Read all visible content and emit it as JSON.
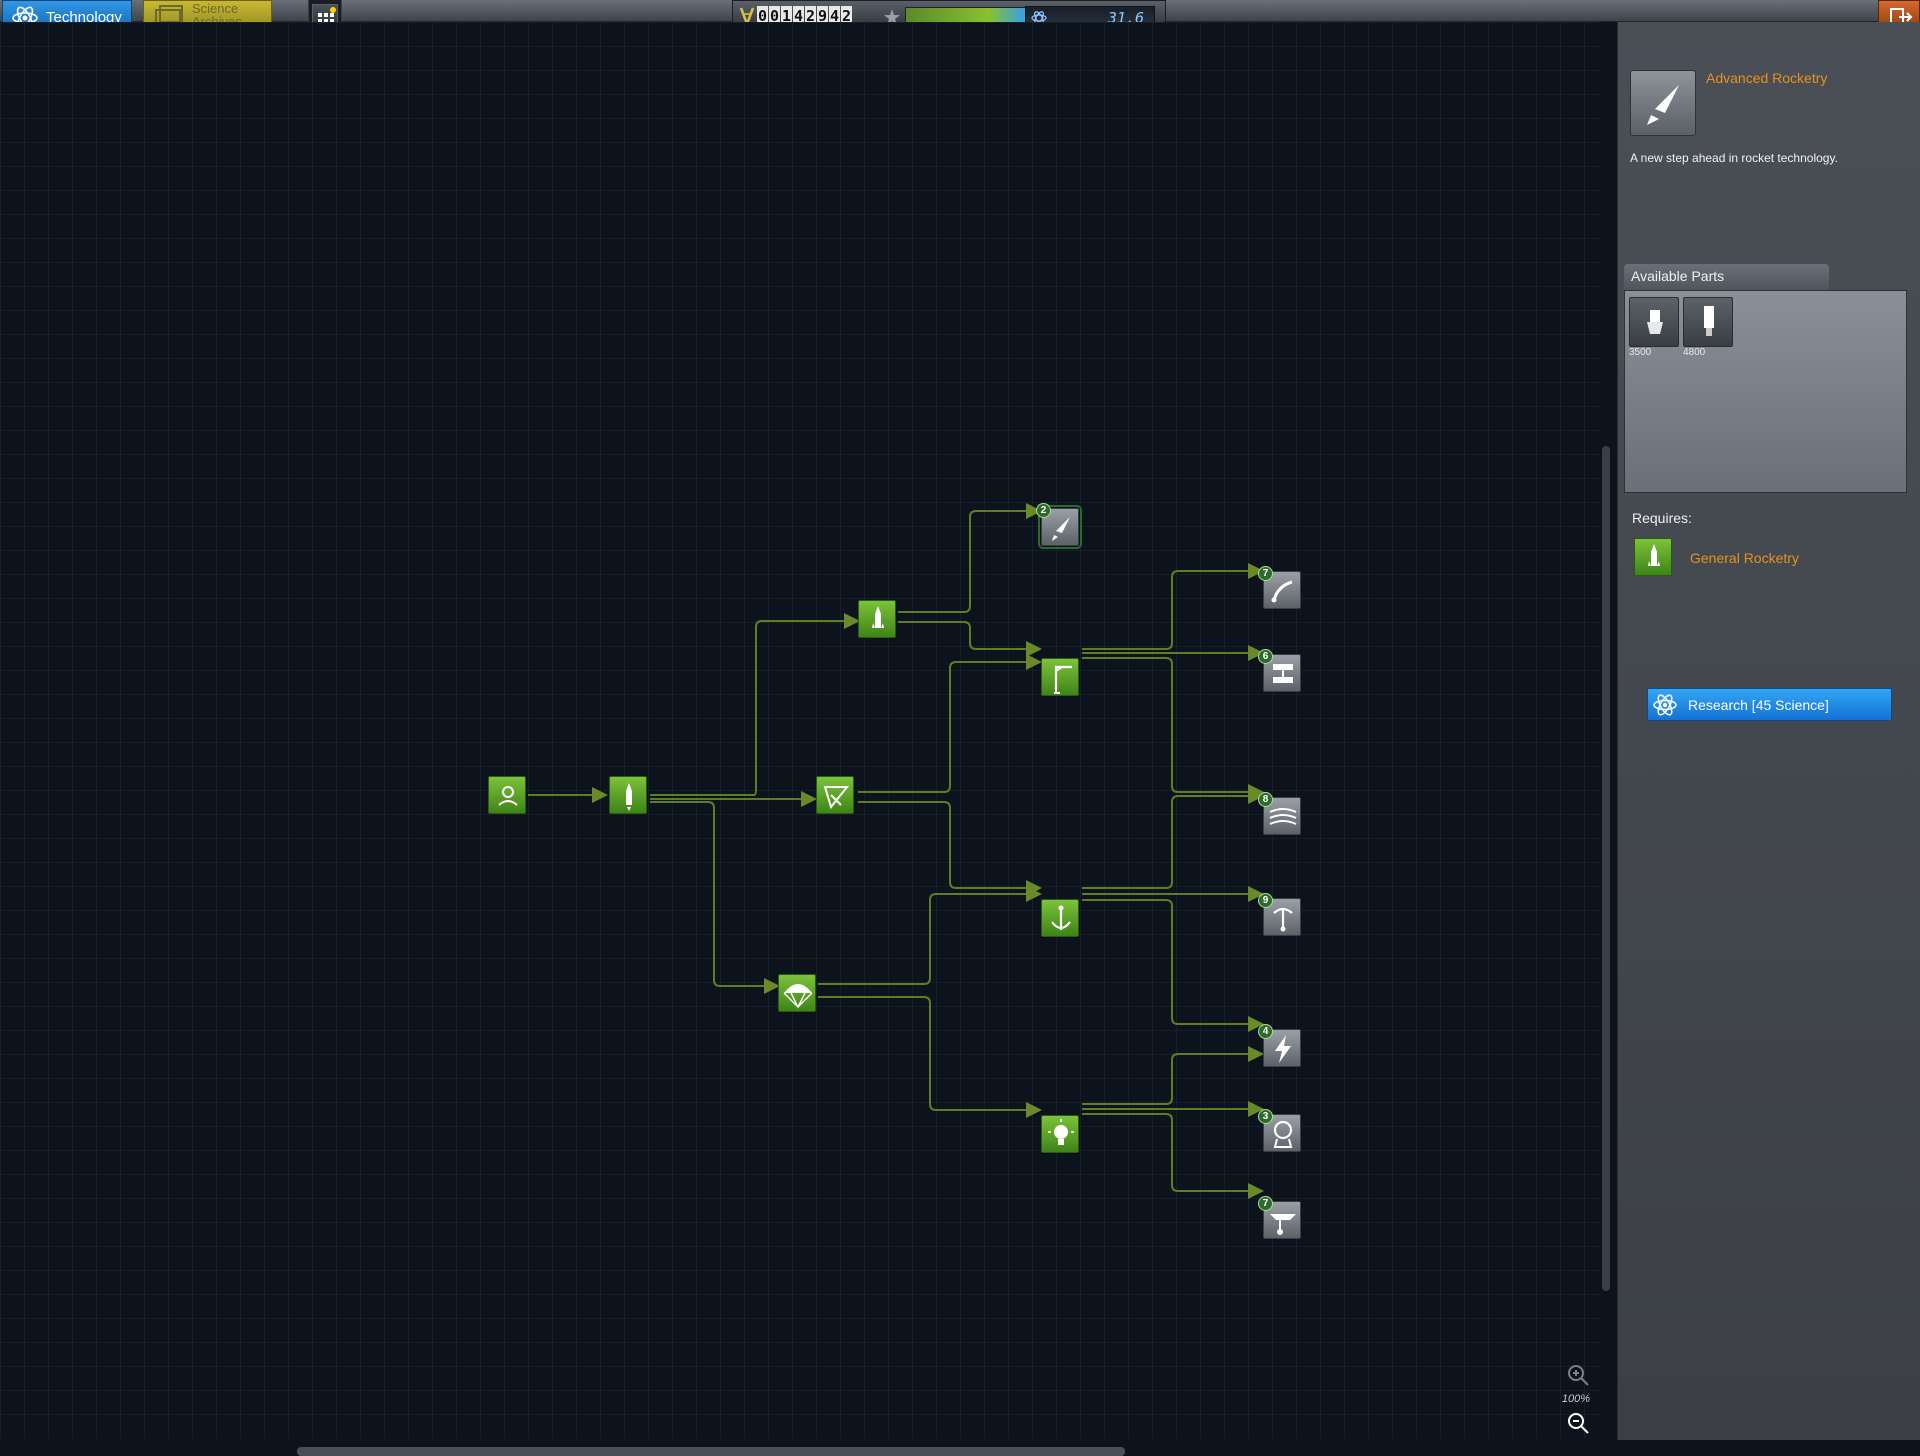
{
  "tabs": {
    "technology": "Technology",
    "science_archives": "Science Archives"
  },
  "hud": {
    "funds_digits": [
      "0",
      "0",
      "1",
      "4",
      "2",
      "9",
      "4",
      "2"
    ],
    "science": "31.6"
  },
  "zoom": "100%",
  "selected_tech": {
    "title": "Advanced Rocketry",
    "description": "A new step ahead in rocket technology.",
    "icon": "rocket-icon"
  },
  "available_parts": {
    "title": "Available Parts",
    "items": [
      {
        "cost": "3500",
        "icon": "engine-icon"
      },
      {
        "cost": "4800",
        "icon": "fuel-tank-icon"
      }
    ]
  },
  "requires": {
    "label": "Requires:",
    "name": "General Rocketry",
    "icon": "rocket-icon"
  },
  "research_button": "Research [45 Science]",
  "colors": {
    "unlocked_node": "#5aa22a",
    "locked_node": "#7a8086",
    "accent_blue": "#1f8ae8",
    "title_orange": "#e89020",
    "connector": "#6a8a2a"
  },
  "tree_nodes": [
    {
      "id": "start",
      "state": "unlocked",
      "icon": "kerbal-icon"
    },
    {
      "id": "basic-rocketry",
      "state": "unlocked",
      "icon": "small-rocket-icon"
    },
    {
      "id": "engineering-101",
      "state": "unlocked",
      "icon": "satellite-dish-icon"
    },
    {
      "id": "general-rocketry",
      "state": "unlocked",
      "icon": "rocket-icon"
    },
    {
      "id": "survivability",
      "state": "unlocked",
      "icon": "parachute-icon"
    },
    {
      "id": "advanced-rocketry",
      "state": "locked",
      "icon": "rocket-icon",
      "badge": "2"
    },
    {
      "id": "general-construction",
      "state": "unlocked",
      "icon": "crane-icon"
    },
    {
      "id": "stability",
      "state": "unlocked",
      "icon": "anchor-icon"
    },
    {
      "id": "basic-science",
      "state": "unlocked",
      "icon": "lightbulb-icon"
    },
    {
      "id": "fuel-systems",
      "state": "locked",
      "icon": "fuel-line-icon",
      "badge": "7"
    },
    {
      "id": "adv-construction",
      "state": "locked",
      "icon": "structure-icon",
      "badge": "6"
    },
    {
      "id": "aviation",
      "state": "locked",
      "icon": "wing-icon",
      "badge": "8"
    },
    {
      "id": "flight-control",
      "state": "locked",
      "icon": "control-icon",
      "badge": "9"
    },
    {
      "id": "electrics",
      "state": "locked",
      "icon": "lightning-icon",
      "badge": "4"
    },
    {
      "id": "space-exploration",
      "state": "locked",
      "icon": "astronaut-icon",
      "badge": "3"
    },
    {
      "id": "landing",
      "state": "locked",
      "icon": "landing-gear-icon",
      "badge": "7"
    }
  ]
}
